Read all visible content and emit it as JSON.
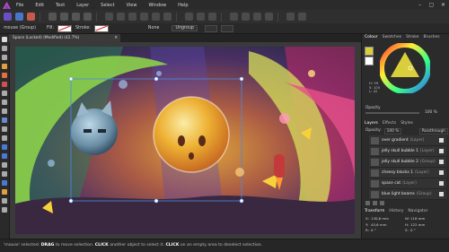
{
  "menubar": {
    "items": [
      "File",
      "Edit",
      "Text",
      "Layer",
      "Select",
      "View",
      "Window",
      "Help"
    ]
  },
  "context": {
    "mode_label": "mouse (Group)",
    "fill_label": "Fill:",
    "stroke_label": "Stroke:",
    "stroke_value": "None",
    "ungroup_label": "Ungroup"
  },
  "document": {
    "tab_title": "Space (Locked) (Modified) (42.7%)"
  },
  "panel": {
    "tabs": [
      "Colour",
      "Swatches",
      "Stroke",
      "Brushes"
    ],
    "color_values": {
      "h": "H: 59",
      "s": "S: 100",
      "l": "L: 42"
    },
    "opacity_label": "Opacity",
    "opacity_value": "100 %",
    "layer_tabs": [
      "Layers",
      "Effects",
      "Styles"
    ],
    "layer_opacity_label": "Opacity:",
    "layer_opacity_value": "100 %",
    "blend_mode": "Passthrough",
    "layers": [
      {
        "name": "over gradient",
        "kind": "(Layer)"
      },
      {
        "name": "jelly skull bubble 1",
        "kind": "(Layer)"
      },
      {
        "name": "jelly skull bubble 2",
        "kind": "(Group)"
      },
      {
        "name": "cheesy blocks 1",
        "kind": "(Layer)"
      },
      {
        "name": "space cat",
        "kind": "(Layer)"
      },
      {
        "name": "blue light beams",
        "kind": "(Group)"
      }
    ],
    "bottom_tabs": [
      "Transform",
      "History",
      "Navigator"
    ],
    "transform": {
      "x_label": "X:",
      "x_value": "130,6 mm",
      "y_label": "Y:",
      "y_value": "45,6 mm",
      "r_label": "R:",
      "r_value": "0 °",
      "w_label": "W:",
      "w_value": "118 mm",
      "h_label": "H:",
      "h_value": "122 mm",
      "s_label": "S:",
      "s_value": "0 °"
    }
  },
  "status": {
    "prefix": "'mouse' selected. ",
    "drag": "DRAG",
    "mid1": " to move selection. ",
    "click1": "CLICK",
    "mid2": " another object to select it. ",
    "click2": "CLICK",
    "suffix": " on an empty area to deselect selection."
  }
}
